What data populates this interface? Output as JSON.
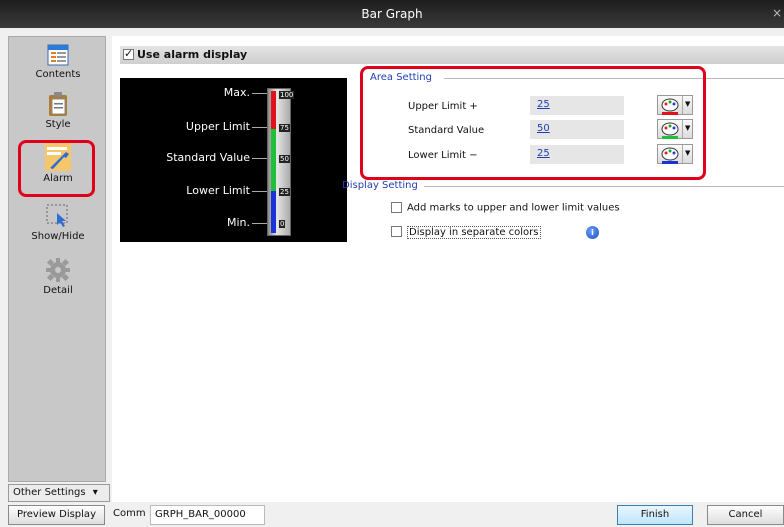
{
  "window": {
    "title": "Bar Graph",
    "close": "×"
  },
  "sidebar": {
    "items": [
      {
        "label": "Contents",
        "icon": "contents-icon"
      },
      {
        "label": "Style",
        "icon": "clipboard-icon"
      },
      {
        "label": "Alarm",
        "icon": "wrench-icon"
      },
      {
        "label": "Show/Hide",
        "icon": "pointer-icon"
      },
      {
        "label": "Detail",
        "icon": "gear-icon"
      }
    ],
    "other_settings": "Other Settings",
    "other_settings_arrow": "▾"
  },
  "main": {
    "use_alarm_label": "Use alarm display",
    "use_alarm_checked": true,
    "preview": {
      "labels": {
        "max": "Max.",
        "upper": "Upper Limit",
        "standard": "Standard Value",
        "lower": "Lower Limit",
        "min": "Min."
      },
      "scale": [
        "100",
        "75",
        "50",
        "25",
        "0"
      ],
      "colors": {
        "upper_bar": "#e0101c",
        "mid_bar": "#1fbf3a",
        "lower_bar": "#1a33d8"
      }
    },
    "area_setting": {
      "title": "Area Setting",
      "rows": [
        {
          "label": "Upper Limit +",
          "value": "25"
        },
        {
          "label": "Standard Value",
          "value": "50"
        },
        {
          "label": "Lower Limit −",
          "value": "25"
        }
      ]
    },
    "display_setting": {
      "title": "Display Setting",
      "options": [
        {
          "label": "Add marks to upper and lower limit values",
          "checked": false
        },
        {
          "label": "Display in separate colors",
          "checked": false
        }
      ]
    }
  },
  "footer": {
    "preview_display": "Preview Display",
    "comm_label": "Comm",
    "comm_value": "GRPH_BAR_00000",
    "finish": "Finish",
    "cancel": "Cancel"
  },
  "colors": {
    "highlight": "#e0001b",
    "link": "#1f3fb0"
  }
}
